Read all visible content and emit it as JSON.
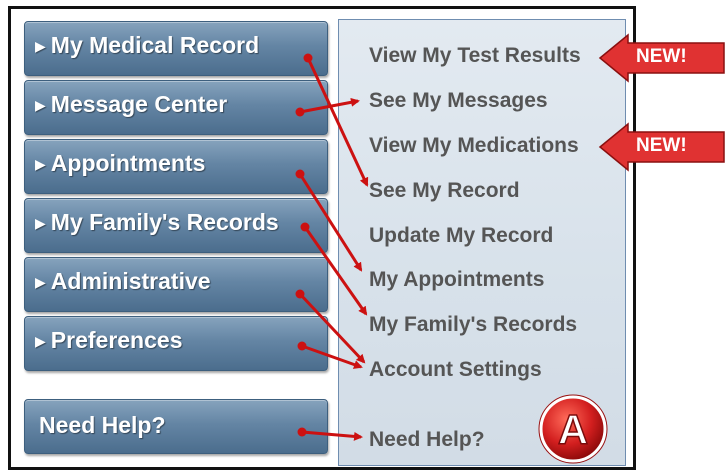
{
  "nav": {
    "my_medical_record": "My Medical Record",
    "message_center": "Message Center",
    "appointments": "Appointments",
    "my_familys_records": "My Family's Records",
    "administrative": "Administrative",
    "preferences": "Preferences",
    "need_help": "Need Help?"
  },
  "links": {
    "view_test_results": "View My Test Results",
    "see_messages": "See My Messages",
    "view_medications": "View My Medications",
    "see_record": "See My Record",
    "update_record": "Update My Record",
    "my_appointments": "My Appointments",
    "my_familys_records": "My Family's Records",
    "account_settings": "Account Settings",
    "need_help": "Need Help?"
  },
  "badges": {
    "test_results_badge": "NEW!",
    "medications_badge": "NEW!"
  },
  "logo": {
    "letter": "A",
    "icon": "a-logo-icon"
  },
  "colors": {
    "button_blue": "#5b7e9f",
    "link_gray": "#555555",
    "arrow_red": "#cc1111",
    "badge_red": "#e23333"
  }
}
